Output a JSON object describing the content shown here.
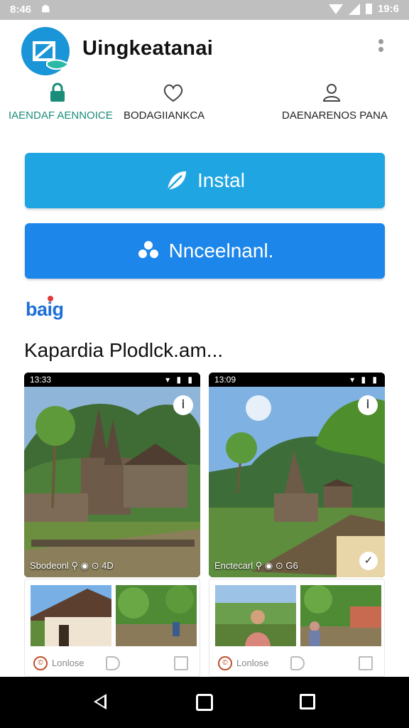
{
  "status_bar": {
    "time": "8:46",
    "notification_icon": "game-controller-icon",
    "battery_text": "19:6"
  },
  "app": {
    "title": "Uingkeatanai"
  },
  "tabs": [
    {
      "label": "IAENDAF AENNOICE",
      "icon": "lock-icon",
      "active": true
    },
    {
      "label": "BODAGIIANKCA",
      "icon": "heart-outline-icon",
      "active": false
    },
    {
      "label": "DAENARENOS PANA",
      "icon": "person-icon",
      "active": false
    }
  ],
  "buttons": {
    "install_label": "Instal",
    "second_label": "Nnceelnanl."
  },
  "brand": "baig",
  "section_title": "Kapardia Plodlck.am...",
  "screenshots": [
    {
      "time": "13:33",
      "caption": "Sbodeonl ⚲ ◉ ⊙ 4D"
    },
    {
      "time": "13:09",
      "caption": "Enctecarl ⚲ ◉ ⊙ G6"
    }
  ],
  "cards": [
    {
      "label": "Lonlose"
    },
    {
      "label": "Lonlose"
    }
  ],
  "colors": {
    "accent_teal": "#1a8c7a",
    "install_button": "#20a5e3",
    "second_button": "#1c86ea",
    "logo": "#1a95d8"
  }
}
